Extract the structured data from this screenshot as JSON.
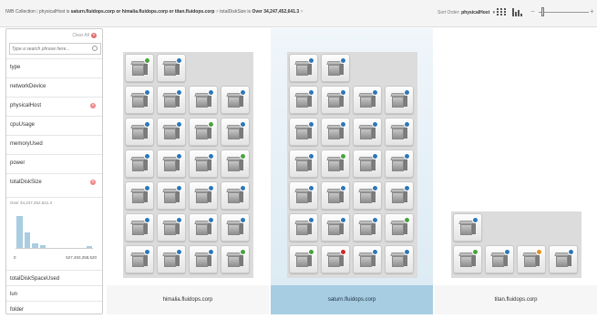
{
  "breadcrumb": {
    "root": "IWB Collection",
    "filter_1_prefix": "physicalHost is",
    "filter_1_value": "saturn.fluidops.corp or himalia.fluidops.corp or titan.fluidops.corp",
    "filter_2_prefix": "totalDiskSize is",
    "filter_2_value": "Over 34,247,452,641.3",
    "separator": "|",
    "arrow": ">"
  },
  "toolbar": {
    "sort_label": "Sort Order:",
    "sort_value": "physicalHost",
    "zoom_out": "−",
    "zoom_in": "+",
    "zoom_level": 0.06
  },
  "panel": {
    "clear_all": "Clear All",
    "search_placeholder": "Type a search phrase here...",
    "facets": [
      {
        "label": "type",
        "active": false
      },
      {
        "label": "networkDevice",
        "active": false
      },
      {
        "label": "physicalHost",
        "active": true
      },
      {
        "label": "cpuUsage",
        "active": false
      },
      {
        "label": "memoryUsed",
        "active": false
      },
      {
        "label": "power",
        "active": false
      },
      {
        "label": "totalDiskSize",
        "active": true
      }
    ],
    "histogram": {
      "subtitle": "Over 34,247,452,641.3",
      "min_label": "0",
      "max_label": "527,493,258,520",
      "bars": [
        0.78,
        0.38,
        0.12,
        0.07,
        0.0,
        0.0,
        0.0,
        0.0,
        0.0,
        0.05
      ]
    },
    "facets_after": [
      {
        "label": "totalDiskSpaceUsed"
      },
      {
        "label": "lun"
      },
      {
        "label": "folder"
      }
    ]
  },
  "columns": [
    {
      "label": "himalia.fluidops.corp",
      "selected": false,
      "rows": [
        [
          "ok",
          "info"
        ],
        [
          "info",
          "info",
          "info",
          "info"
        ],
        [
          "info",
          "info",
          "ok",
          "info"
        ],
        [
          "info",
          "info",
          "info",
          "ok"
        ],
        [
          "info",
          "info",
          "info",
          "info"
        ],
        [
          "info",
          "info",
          "info",
          "info"
        ],
        [
          "info",
          "info",
          "info",
          "ok"
        ]
      ]
    },
    {
      "label": "saturn.fluidops.corp",
      "selected": true,
      "rows": [
        [
          "info",
          "info"
        ],
        [
          "info",
          "info",
          "info",
          "info"
        ],
        [
          "info",
          "info",
          "info",
          "info"
        ],
        [
          "info",
          "ok",
          "info",
          "info"
        ],
        [
          "info",
          "info",
          "info",
          "info"
        ],
        [
          "info",
          "info",
          "info",
          "ok"
        ],
        [
          "ok",
          "err",
          "info",
          "info"
        ]
      ]
    },
    {
      "label": "titan.fluidops.corp",
      "selected": false,
      "rows": [
        [
          "info"
        ],
        [
          "ok",
          "info",
          "warn",
          "info"
        ]
      ]
    }
  ],
  "colors": {
    "info": "#2e77b8",
    "ok": "#4aa23f",
    "warn": "#e59220",
    "err": "#d02828",
    "selected_column": "#a6cde2"
  }
}
